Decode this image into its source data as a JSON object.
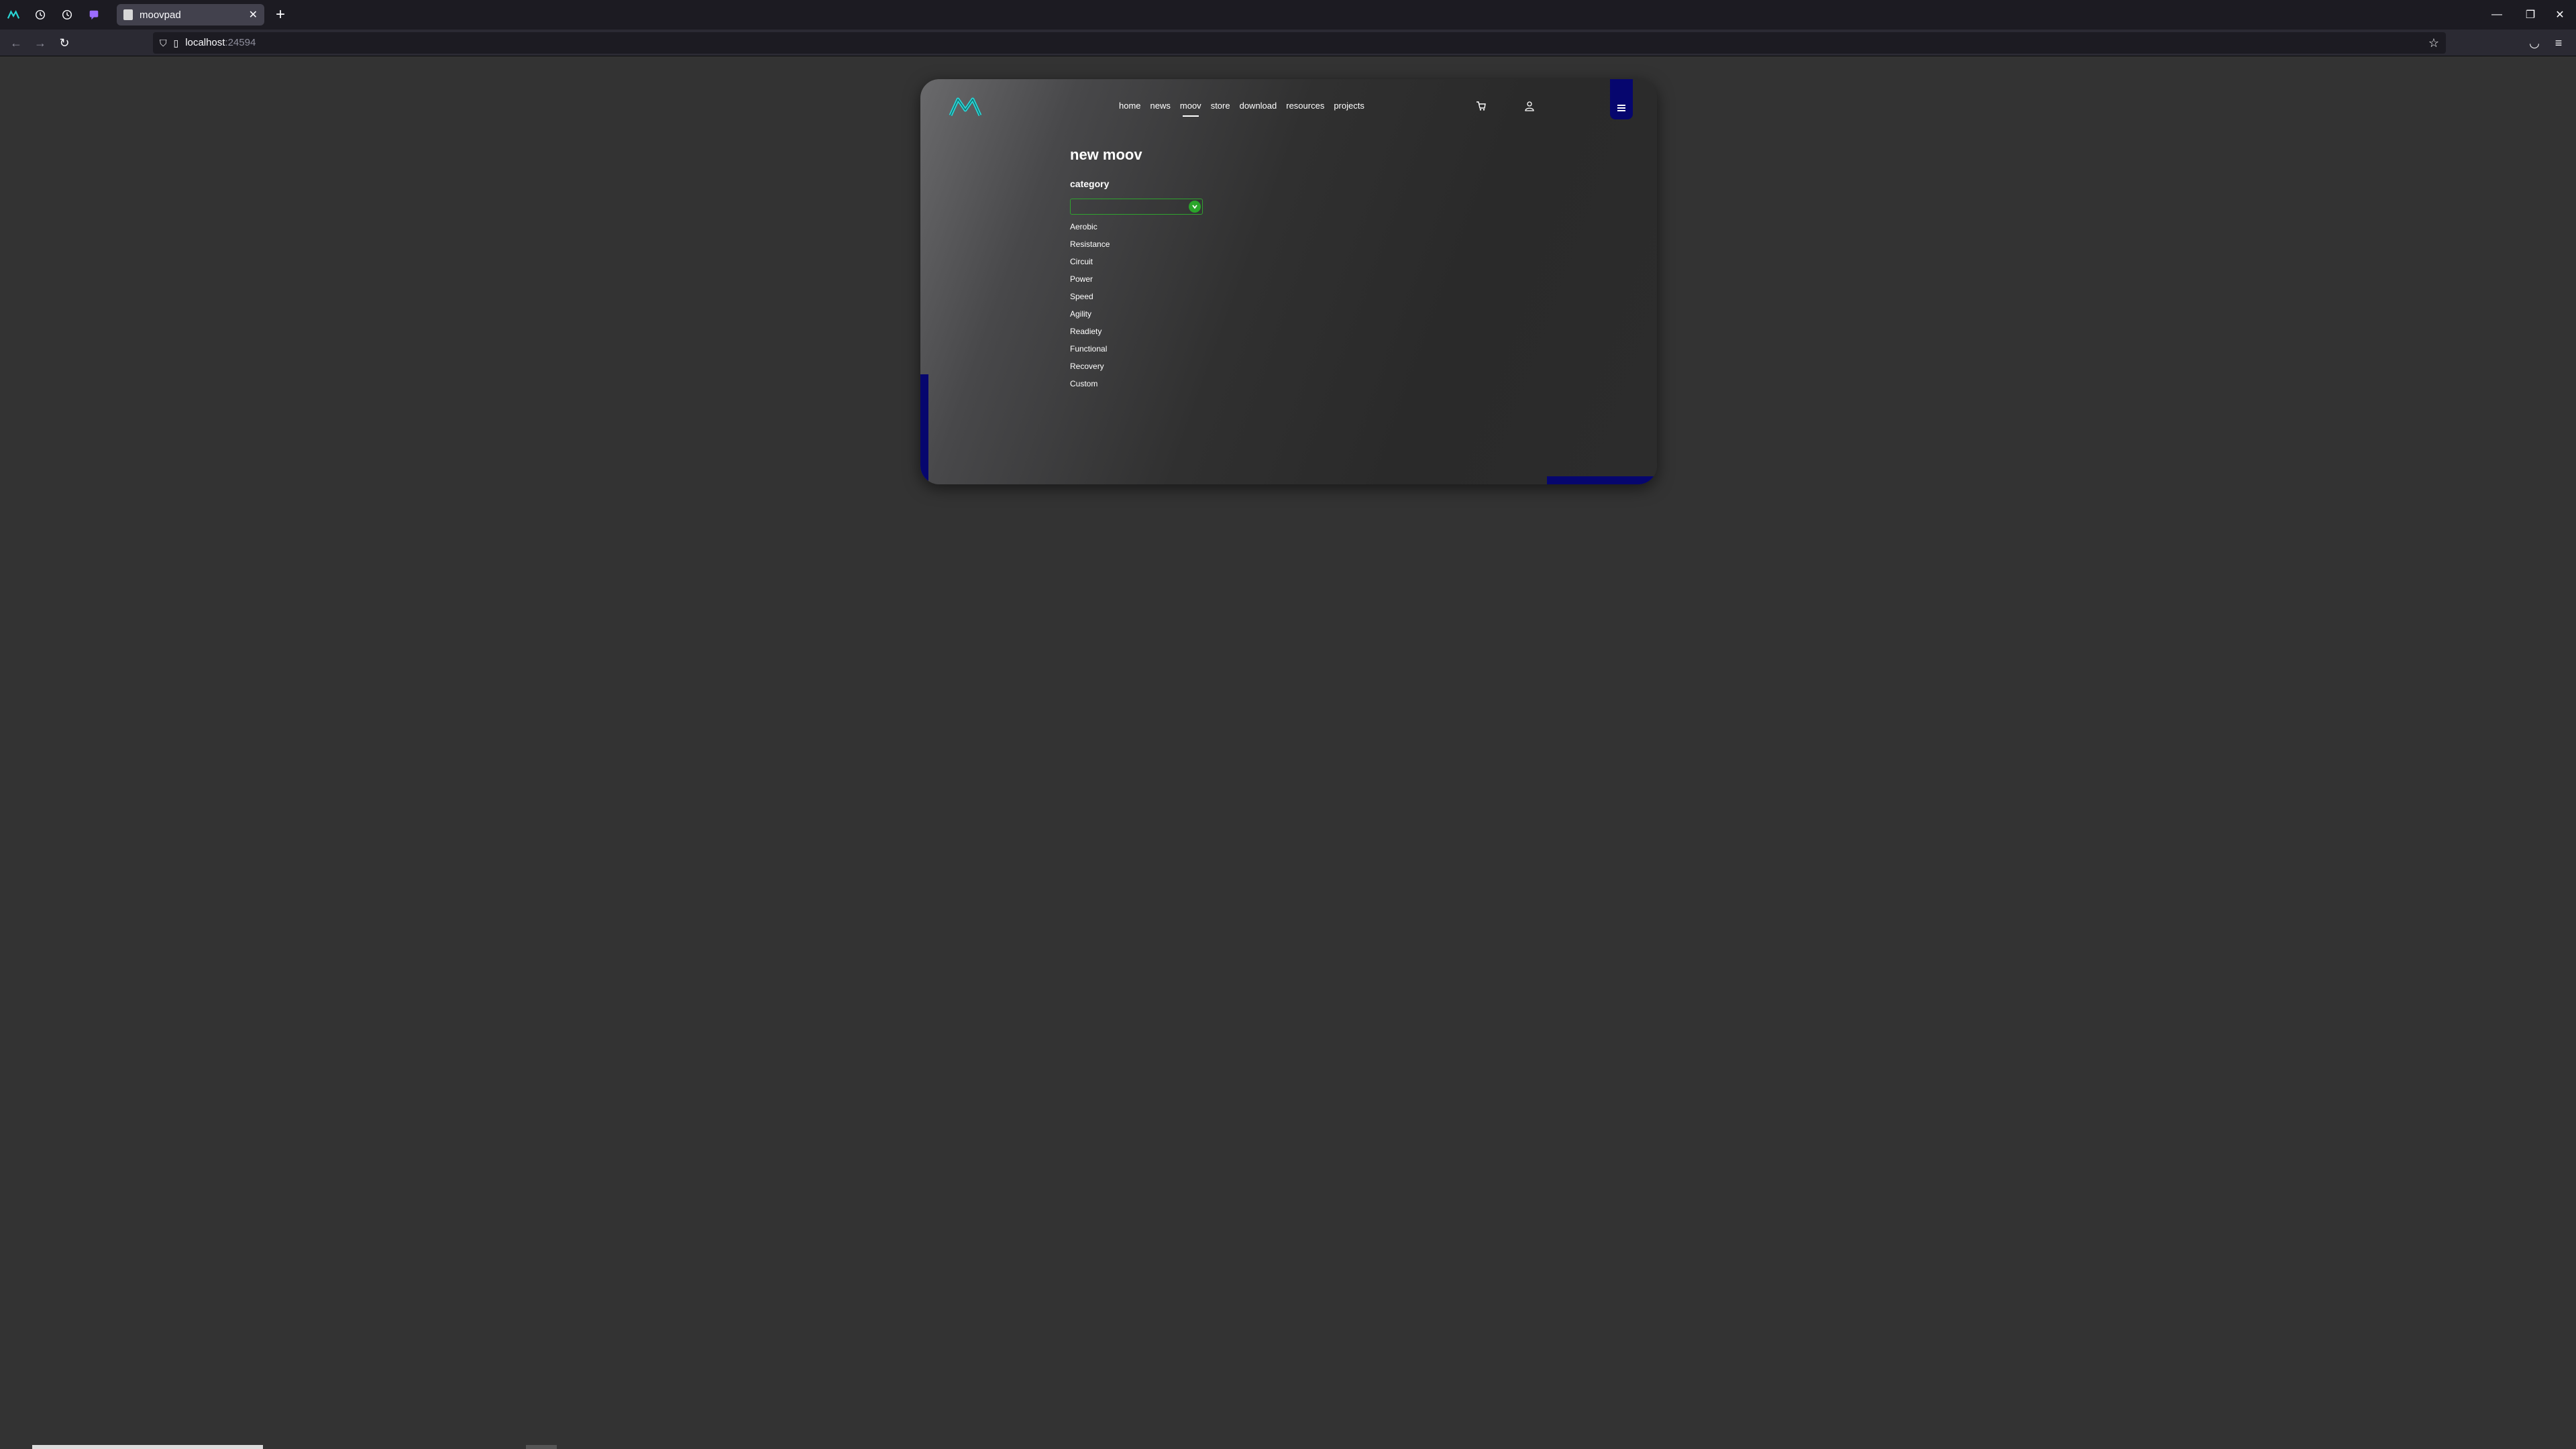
{
  "browser": {
    "tab_title": "moovpad",
    "url_host": "localhost",
    "url_port": ":24594"
  },
  "site": {
    "nav": [
      {
        "label": "home",
        "active": false
      },
      {
        "label": "news",
        "active": false
      },
      {
        "label": "moov",
        "active": true
      },
      {
        "label": "store",
        "active": false
      },
      {
        "label": "download",
        "active": false
      },
      {
        "label": "resources",
        "active": false
      },
      {
        "label": "projects",
        "active": false
      }
    ],
    "icons": {
      "logo": "moovpad-logo",
      "cart": "cart-icon",
      "account": "user-icon",
      "menu": "hamburger-menu-icon"
    },
    "colors": {
      "accent_blue": "#06066e",
      "logo_teal": "#29d6d6",
      "select_green": "#2aa52a"
    }
  },
  "form": {
    "heading": "new moov",
    "category_label": "category",
    "category_value": "",
    "category_options": [
      "Aerobic",
      "Resistance",
      "Circuit",
      "Power",
      "Speed",
      "Agility",
      "Readiety",
      "Functional",
      "Recovery",
      "Custom"
    ]
  }
}
